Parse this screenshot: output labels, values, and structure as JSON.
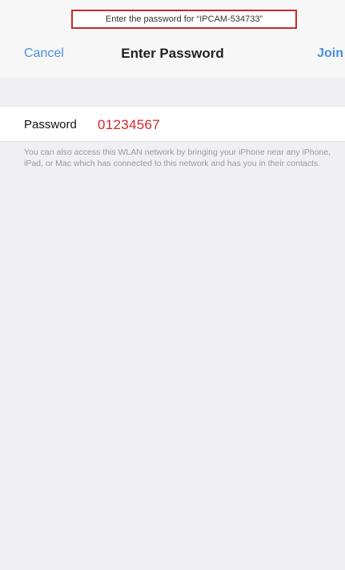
{
  "banner": {
    "text": "Enter the password for “IPCAM-534733”"
  },
  "nav": {
    "cancel_label": "Cancel",
    "title": "Enter Password",
    "join_label": "Join"
  },
  "form": {
    "password_label": "Password",
    "password_value": "01234567"
  },
  "footnote": {
    "text": "You can also access this WLAN network by bringing your iPhone near any iPhone, iPad, or Mac which has connected to this network and has you in their contacts."
  },
  "colors": {
    "accent": "#4a90e2",
    "highlight": "#c8282c",
    "password_text": "#d2262a",
    "background": "#efeff4"
  }
}
